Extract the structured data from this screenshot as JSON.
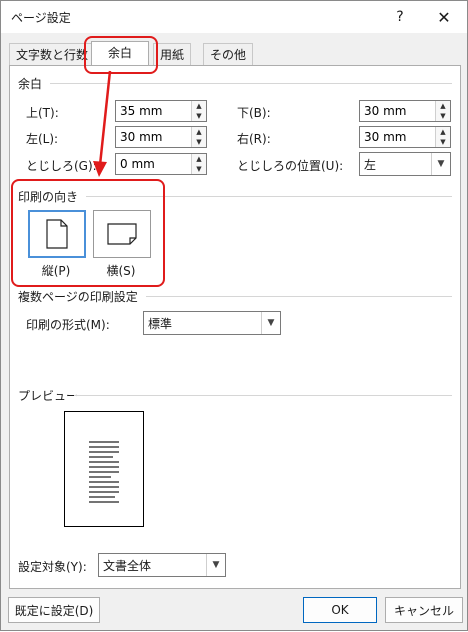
{
  "window": {
    "title": "ページ設定",
    "help_glyph": "?",
    "close_glyph": "✕"
  },
  "tabs": [
    {
      "label": "文字数と行数"
    },
    {
      "label": "余白"
    },
    {
      "label": "用紙"
    },
    {
      "label": "その他"
    }
  ],
  "margins": {
    "title": "余白",
    "top_label": "上(T):",
    "top_value": "35 mm",
    "bottom_label": "下(B):",
    "bottom_value": "30 mm",
    "left_label": "左(L):",
    "left_value": "30 mm",
    "right_label": "右(R):",
    "right_value": "30 mm",
    "gutter_label": "とじしろ(G):",
    "gutter_value": "0 mm",
    "gutter_pos_label": "とじしろの位置(U):",
    "gutter_pos_value": "左"
  },
  "orientation": {
    "title": "印刷の向き",
    "portrait_label": "縦(P)",
    "landscape_label": "横(S)",
    "selected": "portrait"
  },
  "pages": {
    "title": "複数ページの印刷設定",
    "format_label": "印刷の形式(M):",
    "format_value": "標準"
  },
  "preview": {
    "title": "プレビュー"
  },
  "apply": {
    "label": "設定対象(Y):",
    "value": "文書全体"
  },
  "buttons": {
    "default": "既定に設定(D)",
    "ok": "OK",
    "cancel": "キャンセル"
  },
  "colors": {
    "annotation_red": "#e01b1b",
    "selection_blue": "#4a90d9"
  }
}
